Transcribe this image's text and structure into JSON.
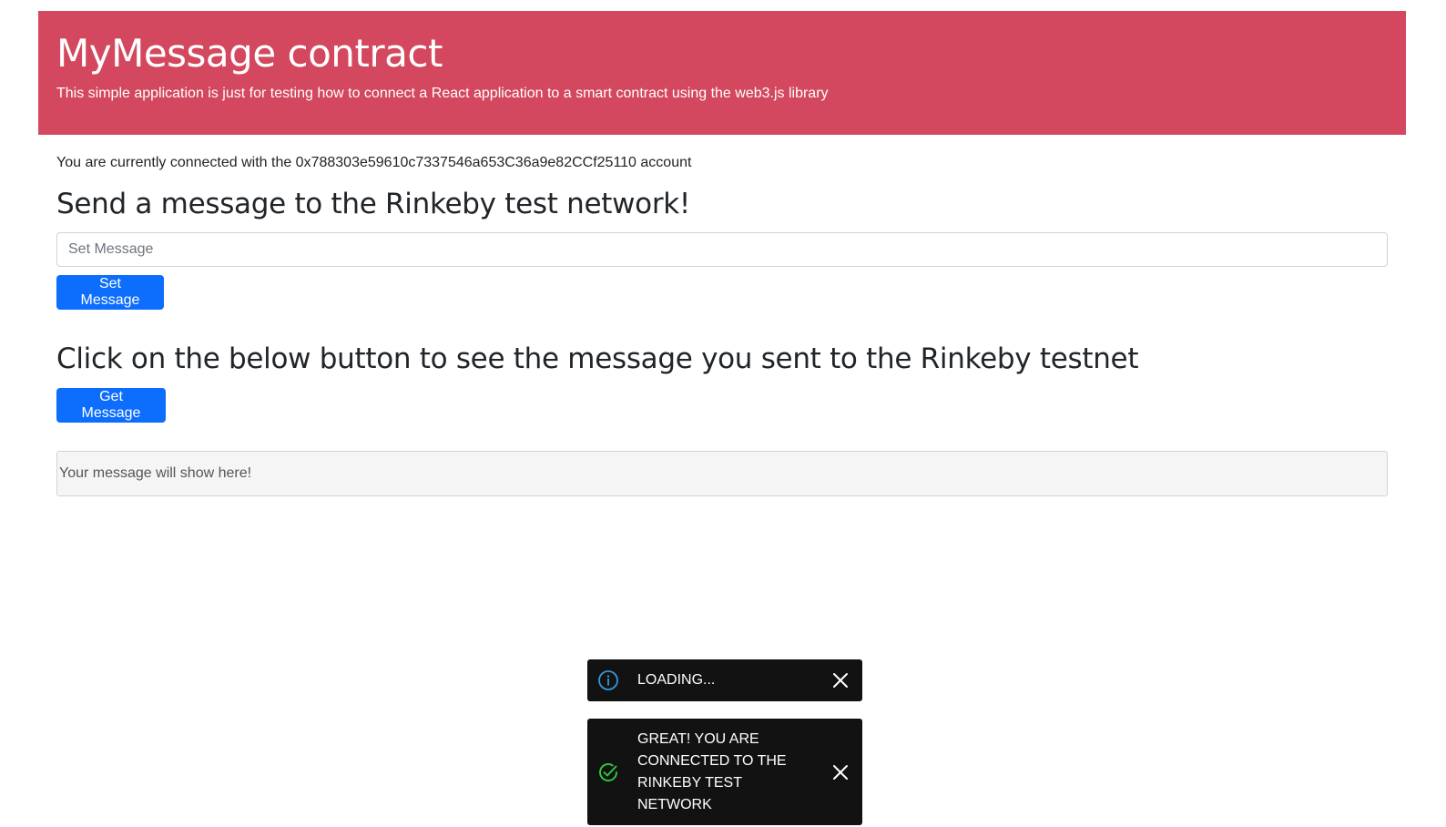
{
  "header": {
    "title": "MyMessage contract",
    "subtitle": "This simple application is just for testing how to connect a React application to a smart contract using the web3.js library",
    "background_color": "#d3485e"
  },
  "account_line": "You are currently connected with the 0x788303e59610c7337546a653C36a9e82CCf25110 account",
  "send_section": {
    "heading": "Send a message to the Rinkeby test network!",
    "input_placeholder": "Set Message",
    "button_label": "Set Message"
  },
  "get_section": {
    "heading": "Click on the below button to see the message you sent to the Rinkeby testnet",
    "button_label": "Get Message",
    "output_text": "Your message will show here!"
  },
  "toasts": [
    {
      "type": "info",
      "icon": "info-icon",
      "text": "Loading...",
      "icon_color": "#3498db"
    },
    {
      "type": "success",
      "icon": "check-circle-icon",
      "text": "Great! You are connected to the Rinkeby test network",
      "icon_color": "#2ecc40"
    }
  ],
  "accent_color": "#0d6efd"
}
